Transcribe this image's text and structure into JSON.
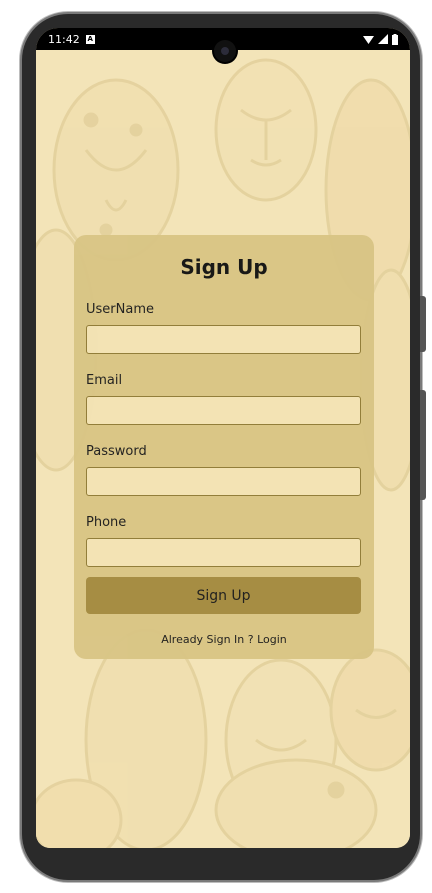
{
  "status_bar": {
    "time": "11:42",
    "sim_indicator": "A"
  },
  "form": {
    "title": "Sign Up",
    "fields": [
      {
        "label": "UserName",
        "value": "",
        "placeholder": ""
      },
      {
        "label": "Email",
        "value": "",
        "placeholder": ""
      },
      {
        "label": "Password",
        "value": "",
        "placeholder": ""
      },
      {
        "label": "Phone",
        "value": "",
        "placeholder": ""
      }
    ],
    "submit_label": "Sign Up",
    "login_link": "Already Sign In ? Login"
  },
  "colors": {
    "background": "#f3e4b8",
    "card": "#d9c585",
    "button": "#a38a3f",
    "input_fill": "#f3e3b4"
  }
}
